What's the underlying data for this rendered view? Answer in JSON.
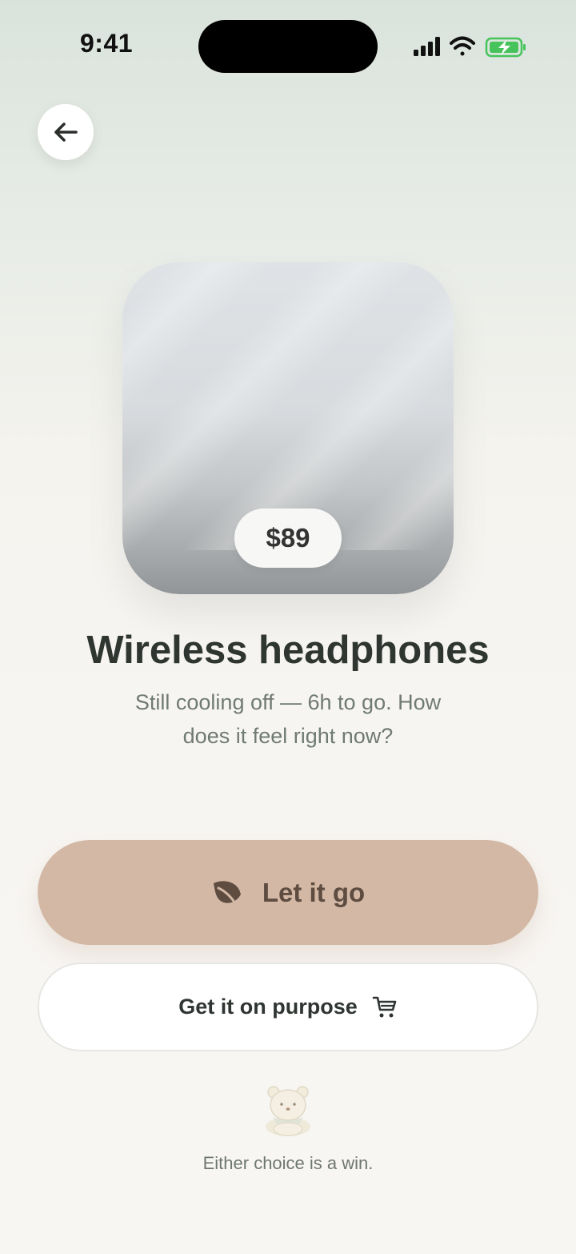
{
  "status_bar": {
    "time": "9:41"
  },
  "product": {
    "price": "$89",
    "name": "Wireless headphones",
    "status_message": "Still cooling off — 6h to go. How does it feel right now?"
  },
  "actions": {
    "primary_label": "Let it go",
    "primary_icon": "leaf-icon",
    "secondary_label": "Get it on purpose",
    "secondary_icon": "cart-icon"
  },
  "footer": {
    "note": "Either choice is a win."
  },
  "colors": {
    "primary_button": "#d3b9a5",
    "primary_text": "#5e4c41",
    "battery_green": "#46c35b"
  }
}
